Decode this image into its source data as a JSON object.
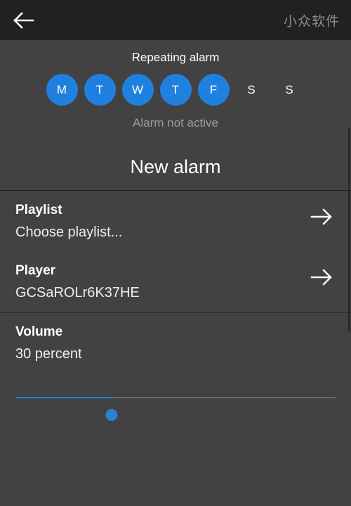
{
  "appbar": {
    "back_icon": "arrow-left-icon",
    "watermark": "小众软件"
  },
  "alarm": {
    "repeat_title": "Repeating alarm",
    "status": "Alarm not active",
    "name": "New alarm",
    "days": [
      {
        "label": "M",
        "selected": true
      },
      {
        "label": "T",
        "selected": true
      },
      {
        "label": "W",
        "selected": true
      },
      {
        "label": "T",
        "selected": true
      },
      {
        "label": "F",
        "selected": true
      },
      {
        "label": "S",
        "selected": false
      },
      {
        "label": "S",
        "selected": false
      }
    ]
  },
  "sections": {
    "source": {
      "playlist": {
        "title": "Playlist",
        "value": "Choose playlist...",
        "arrow_icon": "arrow-right-icon"
      },
      "player": {
        "title": "Player",
        "value": "GCSaROLr6K37HE",
        "arrow_icon": "arrow-right-icon"
      }
    },
    "volume": {
      "title": "Volume",
      "value": "30 percent",
      "percent": 30
    }
  },
  "colors": {
    "accent": "#2080e0",
    "appbar_bg": "#212121",
    "content_bg": "#424242",
    "primary_text": "#ffffff",
    "secondary_text": "#9e9e9e"
  }
}
